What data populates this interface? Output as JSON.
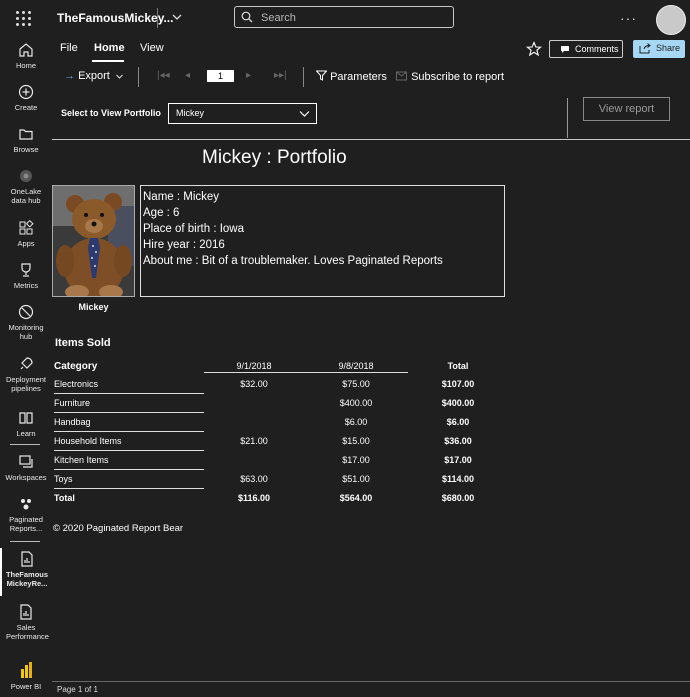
{
  "header": {
    "app_title": "TheFamousMickey...",
    "search_placeholder": "Search"
  },
  "nav": [
    {
      "label": "Home",
      "icon": "home-icon"
    },
    {
      "label": "Create",
      "icon": "plus-circle-icon"
    },
    {
      "label": "Browse",
      "icon": "folder-icon"
    },
    {
      "label": "OneLake data hub",
      "icon": "onelake-icon"
    },
    {
      "label": "Apps",
      "icon": "apps-icon"
    },
    {
      "label": "Metrics",
      "icon": "trophy-icon"
    },
    {
      "label": "Monitoring hub",
      "icon": "monitoring-icon"
    },
    {
      "label": "Deployment pipelines",
      "icon": "rocket-icon"
    },
    {
      "label": "Learn",
      "icon": "book-icon"
    },
    {
      "label": "Workspaces",
      "icon": "workspaces-icon"
    },
    {
      "label": "Paginated Reports...",
      "icon": "paginated-workspace-icon"
    },
    {
      "label": "TheFamous MickeyRe...",
      "icon": "report-icon"
    },
    {
      "label": "Sales Performance",
      "icon": "report-icon"
    },
    {
      "label": "Power BI",
      "icon": "powerbi-logo-icon"
    }
  ],
  "menu": {
    "file": "File",
    "home": "Home",
    "view": "View",
    "comments": "Comments",
    "share": "Share"
  },
  "toolbar": {
    "export": "Export",
    "page_number": "1",
    "parameters": "Parameters",
    "subscribe": "Subscribe to report"
  },
  "params": {
    "label": "Select to View Portfolio",
    "selected": "Mickey",
    "view_report": "View report"
  },
  "report": {
    "title": "Mickey : Portfolio",
    "photo_caption": "Mickey",
    "info": [
      "Name : Mickey",
      "Age : 6",
      "Place of birth : Iowa",
      "Hire year : 2016",
      "About me : Bit of a troublemaker.  Loves Paginated Reports"
    ],
    "items_title": "Items Sold",
    "columns": [
      "Category",
      "9/1/2018",
      "9/8/2018",
      "Total"
    ],
    "rows": [
      {
        "category": "Electronics",
        "d1": "$32.00",
        "d2": "$75.00",
        "total": "$107.00"
      },
      {
        "category": "Furniture",
        "d1": "",
        "d2": "$400.00",
        "total": "$400.00"
      },
      {
        "category": "Handbag",
        "d1": "",
        "d2": "$6.00",
        "total": "$6.00"
      },
      {
        "category": "Household Items",
        "d1": "$21.00",
        "d2": "$15.00",
        "total": "$36.00"
      },
      {
        "category": "Kitchen Items",
        "d1": "",
        "d2": "$17.00",
        "total": "$17.00"
      },
      {
        "category": "Toys",
        "d1": "$63.00",
        "d2": "$51.00",
        "total": "$114.00"
      }
    ],
    "total_row": {
      "category": "Total",
      "d1": "$116.00",
      "d2": "$564.00",
      "total": "$680.00"
    },
    "copyright": "© 2020 Paginated Report Bear",
    "footer": "Page 1 of 1"
  },
  "colors": {
    "background": "#1f1f1f",
    "share_button": "#a6d8f5",
    "powerbi_yellow": "#f2c811"
  }
}
